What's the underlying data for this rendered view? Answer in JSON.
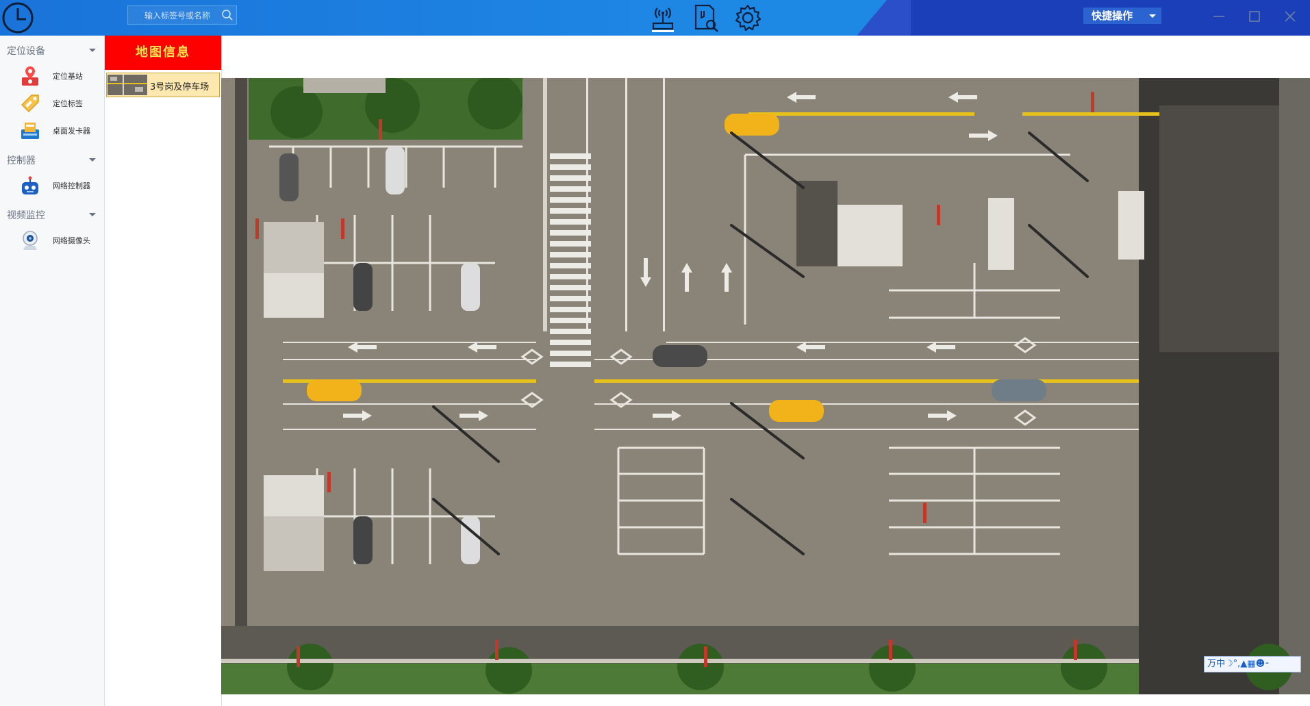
{
  "topbar": {
    "search": {
      "placeholder": "输入标签号或名称"
    },
    "nav_icons": [
      "antenna-router-icon",
      "document-search-icon",
      "gear-icon"
    ],
    "quick_ops": {
      "label": "快捷操作"
    },
    "window_controls": [
      "minimize-icon",
      "maximize-icon",
      "close-icon"
    ]
  },
  "sidebar": {
    "groups": [
      {
        "label": "定位设备",
        "items": [
          {
            "label": "定位基站",
            "icon": "location-base-station-icon"
          },
          {
            "label": "定位标签",
            "icon": "tag-icon"
          },
          {
            "label": "桌面发卡器",
            "icon": "card-issuer-icon"
          }
        ]
      },
      {
        "label": "控制器",
        "items": [
          {
            "label": "网络控制器",
            "icon": "robot-controller-icon"
          }
        ]
      },
      {
        "label": "视频监控",
        "items": [
          {
            "label": "网络摄像头",
            "icon": "webcam-icon"
          }
        ]
      }
    ]
  },
  "map_panel": {
    "title": "地图信息",
    "maps": [
      {
        "label": "3号岗及停车场",
        "selected": true
      }
    ]
  },
  "map": {
    "ime_text": "万中☽°,▲▦☻⁃"
  },
  "colors": {
    "topbar": "#1e88e5",
    "panel_header": "#ff0000",
    "panel_header_text": "#ffe64c",
    "selected_map": "#fde9b0",
    "asphalt": "#8a8478",
    "lane_yellow": "#e6c21a"
  }
}
